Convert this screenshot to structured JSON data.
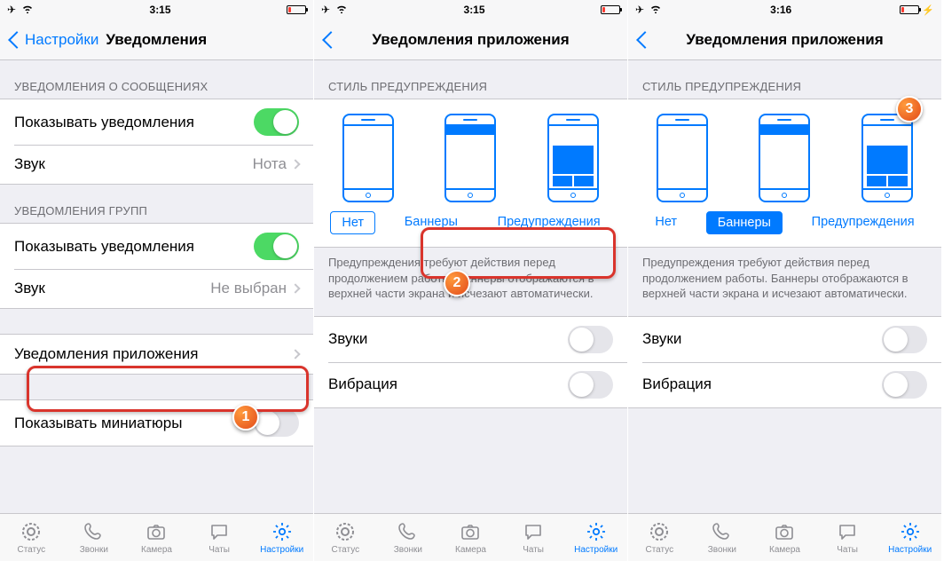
{
  "screen1": {
    "status": {
      "time": "3:15"
    },
    "nav": {
      "back": "Настройки",
      "title": "Уведомления"
    },
    "section_msg_header": "УВЕДОМЛЕНИЯ О СООБЩЕНИЯХ",
    "row_show": "Показывать уведомления",
    "row_sound": "Звук",
    "row_sound_value": "Нота",
    "section_group_header": "УВЕДОМЛЕНИЯ ГРУПП",
    "row_group_show": "Показывать уведомления",
    "row_group_sound": "Звук",
    "row_group_sound_value": "Не выбран",
    "row_app_notifications": "Уведомления приложения",
    "row_thumbnails": "Показывать миниатюры",
    "step_badge": "1"
  },
  "screen2": {
    "status": {
      "time": "3:15"
    },
    "nav": {
      "title": "Уведомления приложения"
    },
    "style_header": "СТИЛЬ ПРЕДУПРЕЖДЕНИЯ",
    "style_none": "Нет",
    "style_banners": "Баннеры",
    "style_alerts": "Предупреждения",
    "style_footer": "Предупреждения требуют действия перед продолжением работы. Баннеры отображаются в верхней части экрана и исчезают автоматически.",
    "row_sounds": "Звуки",
    "row_vibration": "Вибрация",
    "step_badge": "2"
  },
  "screen3": {
    "status": {
      "time": "3:16"
    },
    "nav": {
      "title": "Уведомления приложения"
    },
    "style_header": "СТИЛЬ ПРЕДУПРЕЖДЕНИЯ",
    "style_none": "Нет",
    "style_banners": "Баннеры",
    "style_alerts": "Предупреждения",
    "style_footer": "Предупреждения требуют действия перед продолжением работы. Баннеры отображаются в верхней части экрана и исчезают автоматически.",
    "row_sounds": "Звуки",
    "row_vibration": "Вибрация",
    "step_badge": "3"
  },
  "tabs": {
    "status": "Статус",
    "calls": "Звонки",
    "camera": "Камера",
    "chats": "Чаты",
    "settings": "Настройки"
  }
}
